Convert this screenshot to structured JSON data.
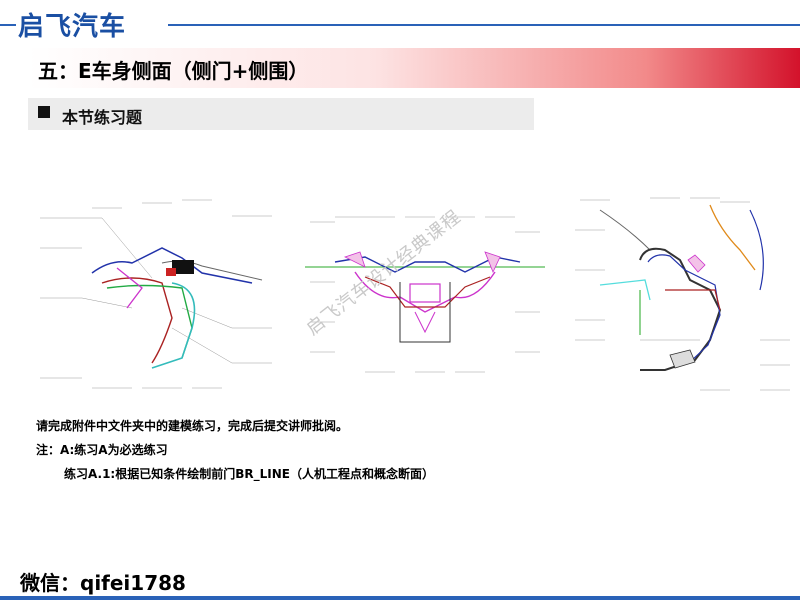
{
  "header": {
    "brand": "启飞汽车",
    "title": "五：E车身侧面（侧门+侧围）"
  },
  "section": {
    "heading": "本节练习题"
  },
  "figures": {
    "watermark": "启飞汽车设计经典课程"
  },
  "instructions": {
    "line1": "请完成附件中文件夹中的建模练习，完成后提交讲师批阅。",
    "line2": "注：A:练习A为必选练习",
    "line3": "练习A.1:根据已知条件绘制前门BR_LINE（人机工程点和概念断面）"
  },
  "footer": {
    "wechat": "微信：qifei1788"
  },
  "colors": {
    "brand_blue": "#1a4fa3",
    "accent_red": "#d3122b"
  }
}
